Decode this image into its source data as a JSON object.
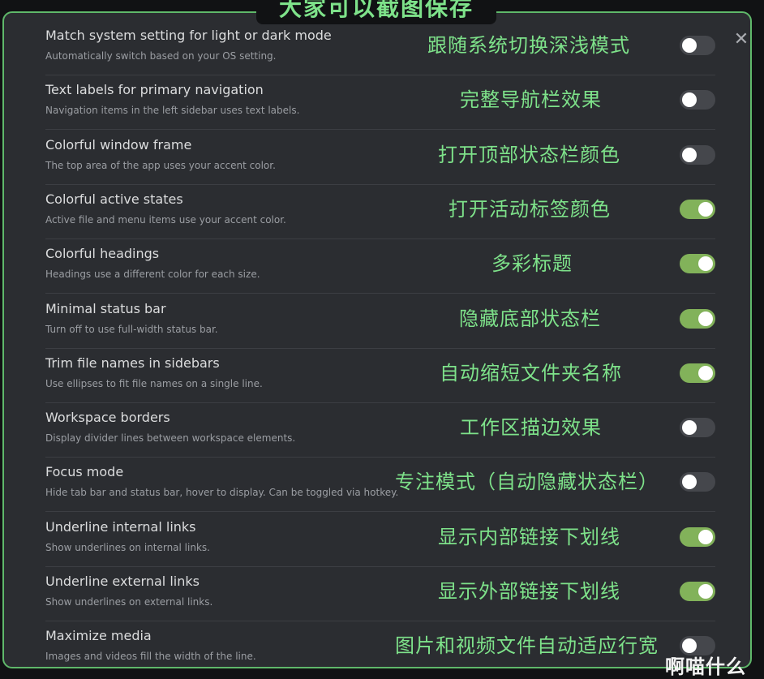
{
  "banner": "大家可以截图保存",
  "watermark": "啊喵什么",
  "close_icon": "close-icon",
  "accent_color": "#82b25a",
  "settings": [
    {
      "title": "Match system setting for light or dark mode",
      "desc": "Automatically switch based on your OS setting.",
      "note": "跟随系统切换深浅模式",
      "on": false
    },
    {
      "title": "Text labels for primary navigation",
      "desc": "Navigation items in the left sidebar uses text labels.",
      "note": "完整导航栏效果",
      "on": false
    },
    {
      "title": "Colorful window frame",
      "desc": "The top area of the app uses your accent color.",
      "note": "打开顶部状态栏颜色",
      "on": false
    },
    {
      "title": "Colorful active states",
      "desc": "Active file and menu items use your accent color.",
      "note": "打开活动标签颜色",
      "on": true
    },
    {
      "title": "Colorful headings",
      "desc": "Headings use a different color for each size.",
      "note": "多彩标题",
      "on": true
    },
    {
      "title": "Minimal status bar",
      "desc": "Turn off to use full-width status bar.",
      "note": "隐藏底部状态栏",
      "on": true
    },
    {
      "title": "Trim file names in sidebars",
      "desc": "Use ellipses to fit file names on a single line.",
      "note": "自动缩短文件夹名称",
      "on": true
    },
    {
      "title": "Workspace borders",
      "desc": "Display divider lines between workspace elements.",
      "note": "工作区描边效果",
      "on": false
    },
    {
      "title": "Focus mode",
      "desc": "Hide tab bar and status bar, hover to display. Can be toggled via hotkey.",
      "note": "专注模式（自动隐藏状态栏）",
      "on": false
    },
    {
      "title": "Underline internal links",
      "desc": "Show underlines on internal links.",
      "note": "显示内部链接下划线",
      "on": true
    },
    {
      "title": "Underline external links",
      "desc": "Show underlines on external links.",
      "note": "显示外部链接下划线",
      "on": true
    },
    {
      "title": "Maximize media",
      "desc": "Images and videos fill the width of the line.",
      "note": "图片和视频文件自动适应行宽",
      "on": false
    }
  ]
}
